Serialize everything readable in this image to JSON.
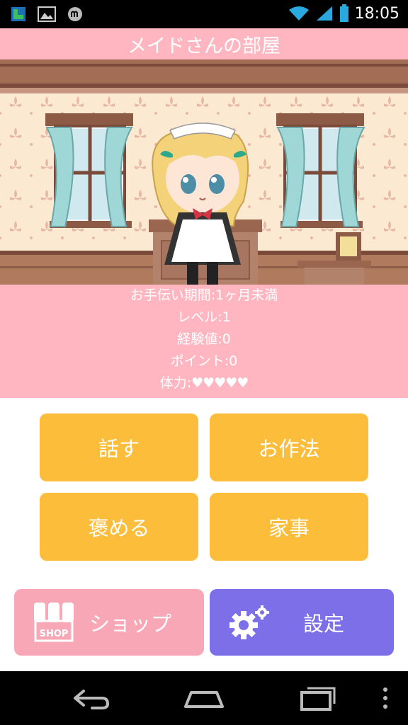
{
  "status_bar": {
    "time": "18:05",
    "icons": [
      "notification-app-icon",
      "gallery-icon",
      "message-icon",
      "wifi-icon",
      "signal-icon",
      "battery-icon"
    ]
  },
  "header": {
    "title": "メイドさんの部屋"
  },
  "stats": {
    "period": "お手伝い期間:1ヶ月未満",
    "level": "レベル:1",
    "experience": "経験値:0",
    "points": "ポイント:0",
    "stamina_label": "体力:",
    "stamina_hearts": "♥♥♥♥♥",
    "stamina_value": 5,
    "stamina_max": 5
  },
  "actions": {
    "talk": "話す",
    "manners": "お作法",
    "praise": "褒める",
    "chores": "家事"
  },
  "footer_buttons": {
    "shop_label": "ショップ",
    "shop_icon_text": "SHOP",
    "settings_label": "設定"
  },
  "colors": {
    "pink": "#ffb6c1",
    "action_yellow": "#fbbd3a",
    "shop_pink": "#f8a7b6",
    "settings_purple": "#7d6fe8"
  }
}
